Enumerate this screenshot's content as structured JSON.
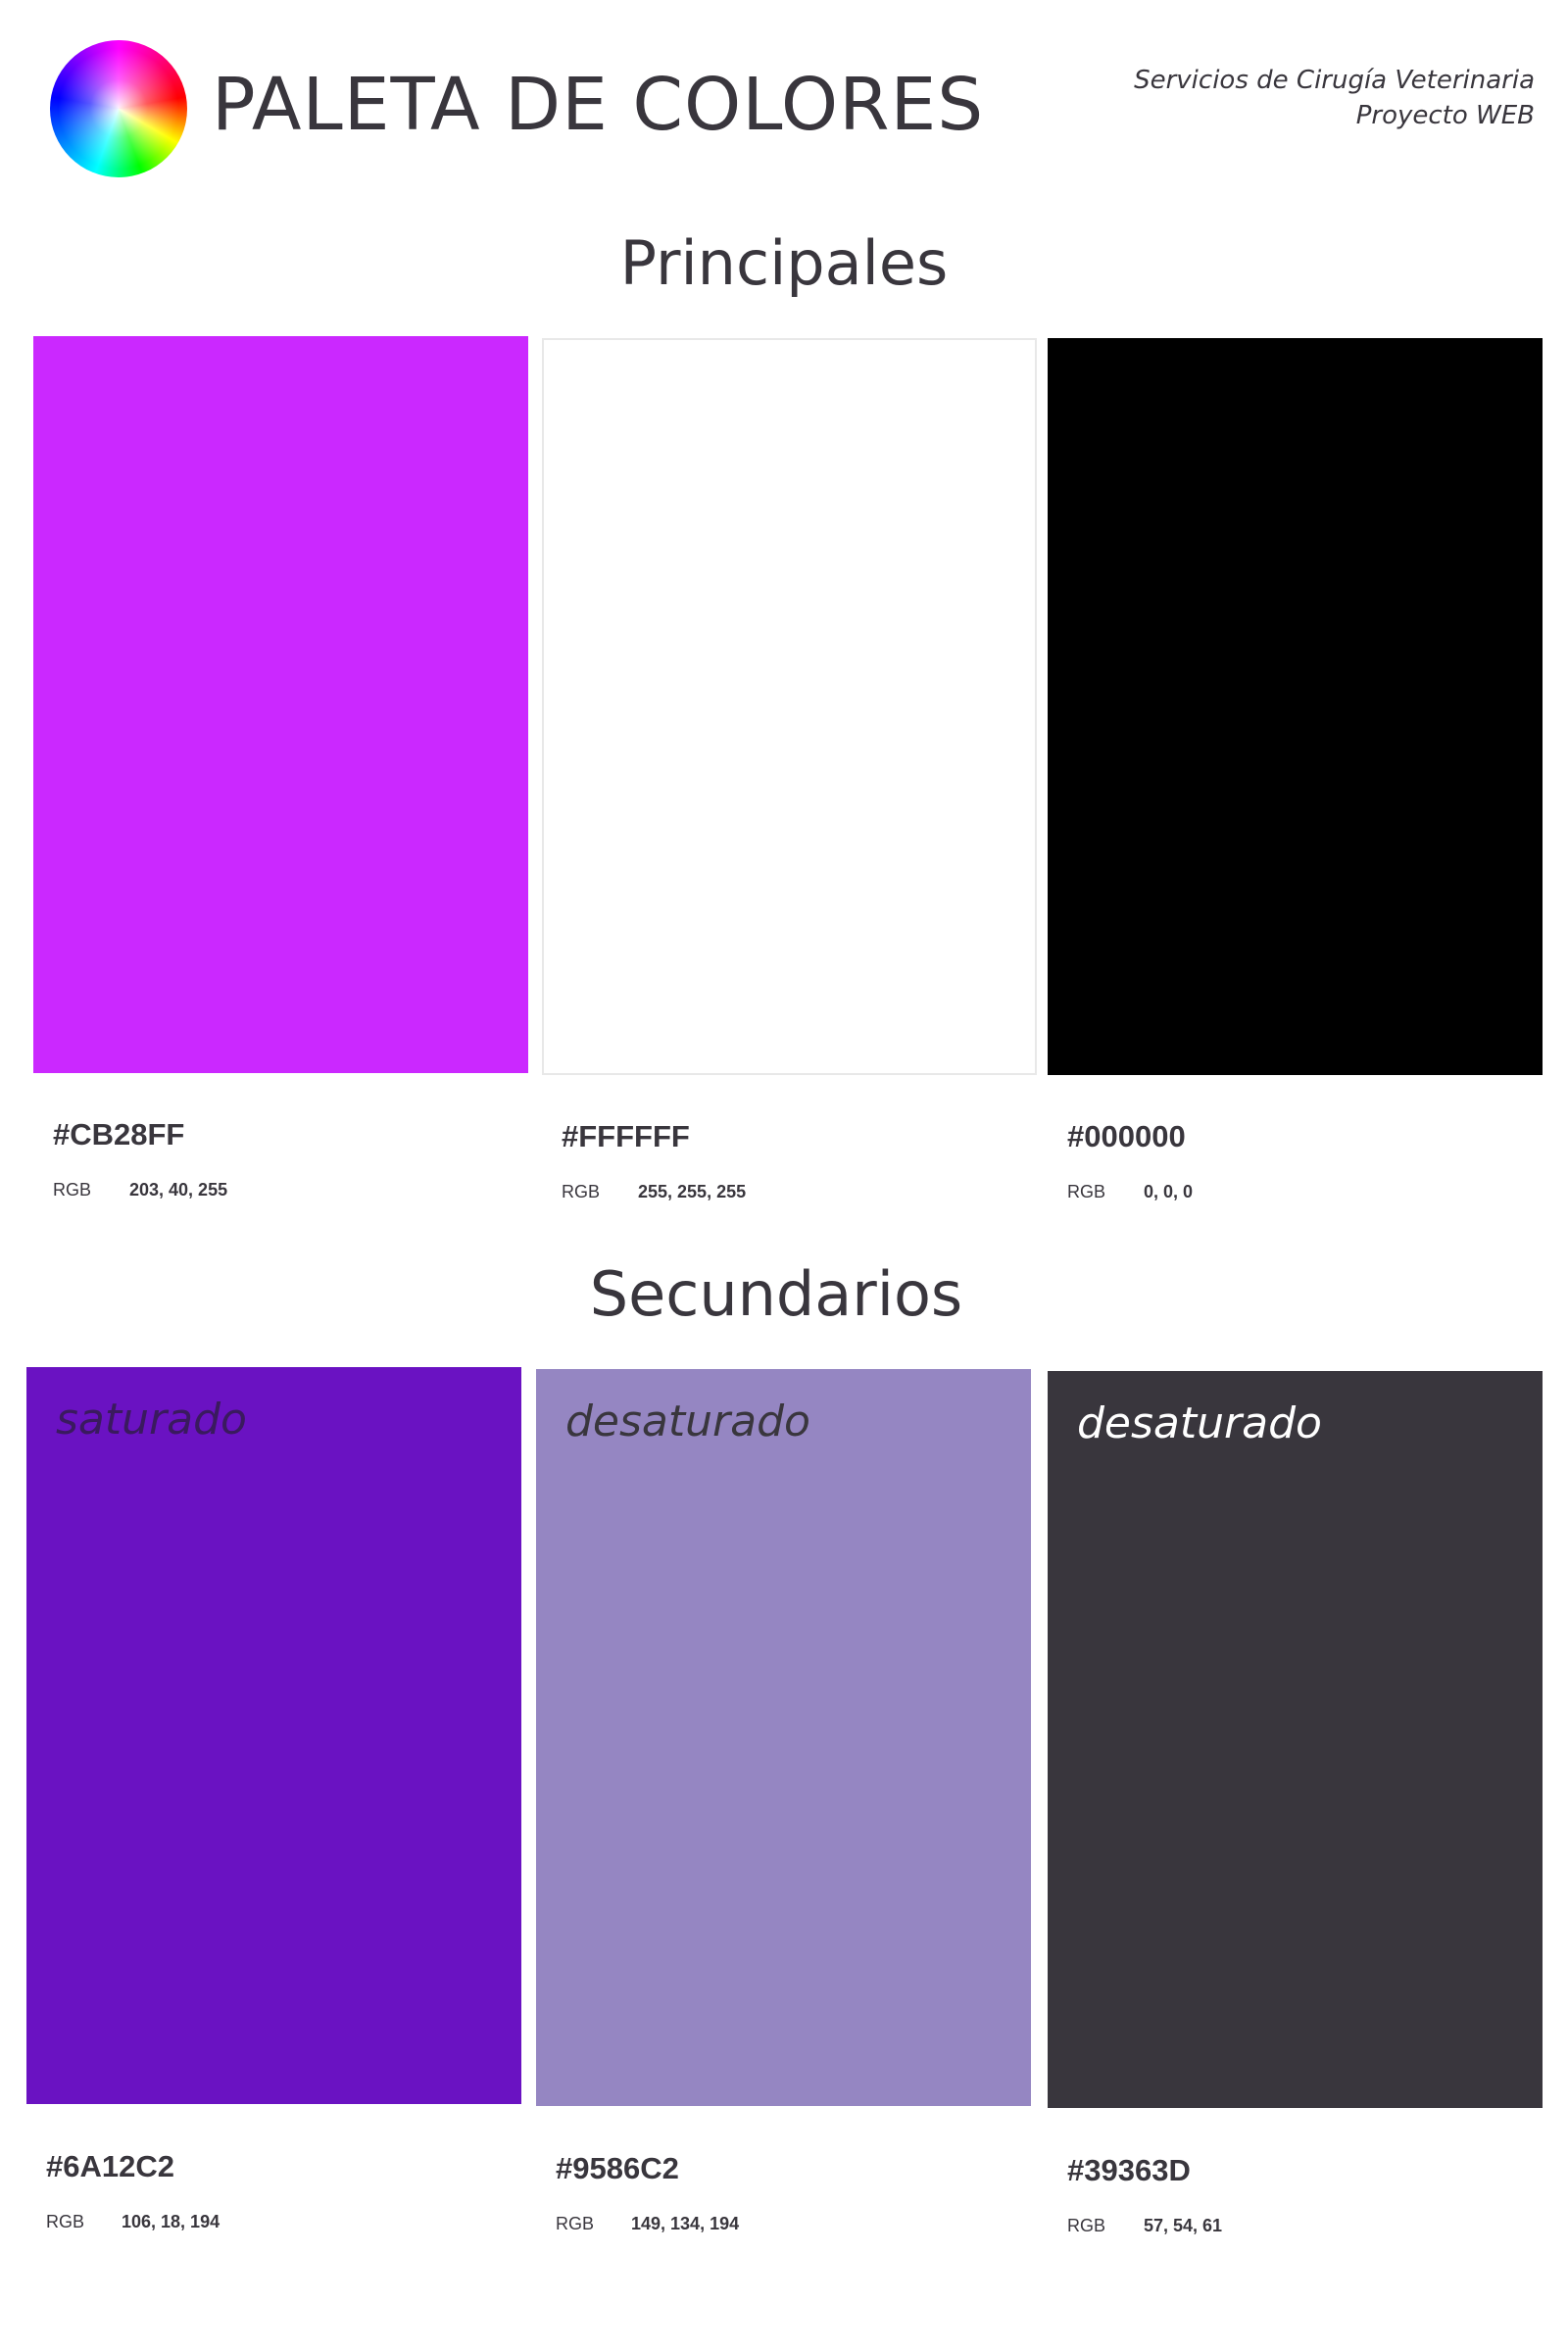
{
  "header": {
    "title": "PALETA DE COLORES",
    "subtitle_line1": "Servicios de Cirugía Veterinaria",
    "subtitle_line2": "Proyecto WEB",
    "icon": "color-wheel-icon"
  },
  "principales": {
    "title": "Principales",
    "swatches": [
      {
        "color": "#CB28FF",
        "hex": "#CB28FF",
        "rgb_label": "RGB",
        "rgb": "203, 40, 255"
      },
      {
        "color": "#FFFFFF",
        "hex": "#FFFFFF",
        "rgb_label": "RGB",
        "rgb": "255, 255, 255"
      },
      {
        "color": "#000000",
        "hex": "#000000",
        "rgb_label": "RGB",
        "rgb": "0, 0, 0"
      }
    ]
  },
  "secundarios": {
    "title": "Secundarios",
    "swatches": [
      {
        "color": "#6A12C2",
        "label": "saturado",
        "label_color": "#3a1a5e",
        "hex": "#6A12C2",
        "rgb_label": "RGB",
        "rgb": "106, 18, 194"
      },
      {
        "color": "#9586C2",
        "label": "desaturado",
        "label_color": "#39363D",
        "hex": "#9586C2",
        "rgb_label": "RGB",
        "rgb": "149, 134, 194"
      },
      {
        "color": "#39363D",
        "label": "desaturado",
        "label_color": "#FFFFFF",
        "hex": "#39363D",
        "rgb_label": "RGB",
        "rgb": "57, 54, 61"
      }
    ]
  }
}
